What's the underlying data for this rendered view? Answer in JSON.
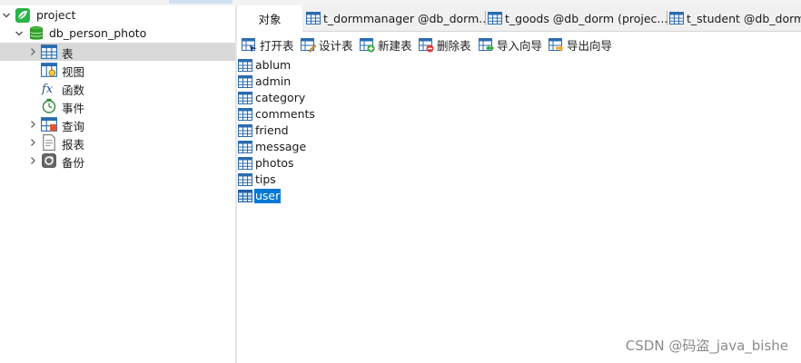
{
  "colors": {
    "selection": "#0078d7",
    "tree_selected": "#d9d9d9",
    "tab_bar": "#f0f0f0",
    "table_icon": "#2b6cb0",
    "db_icon": "#35a02b"
  },
  "tree": {
    "connection": {
      "label": "project",
      "icon": "navicat-leaf-icon",
      "expanded": true
    },
    "database": {
      "label": "db_person_photo",
      "icon": "database-icon",
      "expanded": true
    },
    "items": [
      {
        "label": "表",
        "icon": "table-icon",
        "expandable": true,
        "selected": true
      },
      {
        "label": "视图",
        "icon": "view-icon",
        "expandable": false
      },
      {
        "label": "函数",
        "icon": "function-icon",
        "expandable": false
      },
      {
        "label": "事件",
        "icon": "event-icon",
        "expandable": false
      },
      {
        "label": "查询",
        "icon": "query-icon",
        "expandable": true
      },
      {
        "label": "报表",
        "icon": "report-icon",
        "expandable": true
      },
      {
        "label": "备份",
        "icon": "backup-icon",
        "expandable": true
      }
    ]
  },
  "tabs": [
    {
      "label": "对象",
      "active": true
    },
    {
      "label": "t_dormmanager @db_dorm...",
      "icon": "table-icon"
    },
    {
      "label": "t_goods @db_dorm (projec...",
      "icon": "table-icon"
    },
    {
      "label": "t_student @db_dorm",
      "icon": "table-icon"
    }
  ],
  "toolbar": {
    "open": "打开表",
    "design": "设计表",
    "new": "新建表",
    "delete": "删除表",
    "import": "导入向导",
    "export": "导出向导"
  },
  "objects": [
    {
      "name": "ablum"
    },
    {
      "name": "admin"
    },
    {
      "name": "category"
    },
    {
      "name": "comments"
    },
    {
      "name": "friend"
    },
    {
      "name": "message"
    },
    {
      "name": "photos"
    },
    {
      "name": "tips"
    },
    {
      "name": "user",
      "selected": true
    }
  ],
  "watermark": "CSDN @码盗_java_bishe"
}
